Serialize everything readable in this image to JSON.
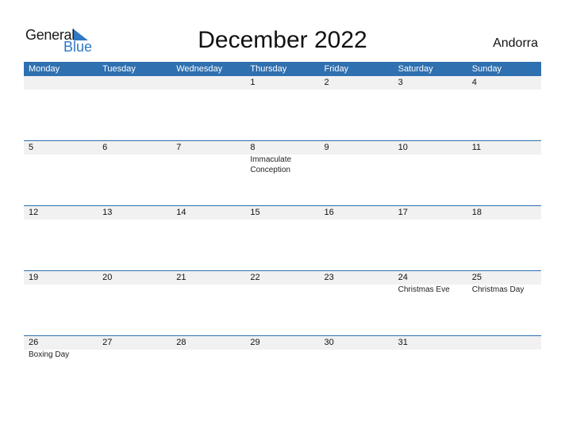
{
  "logo": {
    "word1": "General",
    "word2": "Blue",
    "accent": "#2f78c4"
  },
  "title": "December 2022",
  "country": "Andorra",
  "header_color": "#2f70b0",
  "weekdays": [
    "Monday",
    "Tuesday",
    "Wednesday",
    "Thursday",
    "Friday",
    "Saturday",
    "Sunday"
  ],
  "weeks": [
    [
      {
        "d": "",
        "h": ""
      },
      {
        "d": "",
        "h": ""
      },
      {
        "d": "",
        "h": ""
      },
      {
        "d": "1",
        "h": ""
      },
      {
        "d": "2",
        "h": ""
      },
      {
        "d": "3",
        "h": ""
      },
      {
        "d": "4",
        "h": ""
      }
    ],
    [
      {
        "d": "5",
        "h": ""
      },
      {
        "d": "6",
        "h": ""
      },
      {
        "d": "7",
        "h": ""
      },
      {
        "d": "8",
        "h": "Immaculate Conception"
      },
      {
        "d": "9",
        "h": ""
      },
      {
        "d": "10",
        "h": ""
      },
      {
        "d": "11",
        "h": ""
      }
    ],
    [
      {
        "d": "12",
        "h": ""
      },
      {
        "d": "13",
        "h": ""
      },
      {
        "d": "14",
        "h": ""
      },
      {
        "d": "15",
        "h": ""
      },
      {
        "d": "16",
        "h": ""
      },
      {
        "d": "17",
        "h": ""
      },
      {
        "d": "18",
        "h": ""
      }
    ],
    [
      {
        "d": "19",
        "h": ""
      },
      {
        "d": "20",
        "h": ""
      },
      {
        "d": "21",
        "h": ""
      },
      {
        "d": "22",
        "h": ""
      },
      {
        "d": "23",
        "h": ""
      },
      {
        "d": "24",
        "h": "Christmas Eve"
      },
      {
        "d": "25",
        "h": "Christmas Day"
      }
    ],
    [
      {
        "d": "26",
        "h": "Boxing Day"
      },
      {
        "d": "27",
        "h": ""
      },
      {
        "d": "28",
        "h": ""
      },
      {
        "d": "29",
        "h": ""
      },
      {
        "d": "30",
        "h": ""
      },
      {
        "d": "31",
        "h": ""
      },
      {
        "d": "",
        "h": ""
      }
    ]
  ]
}
